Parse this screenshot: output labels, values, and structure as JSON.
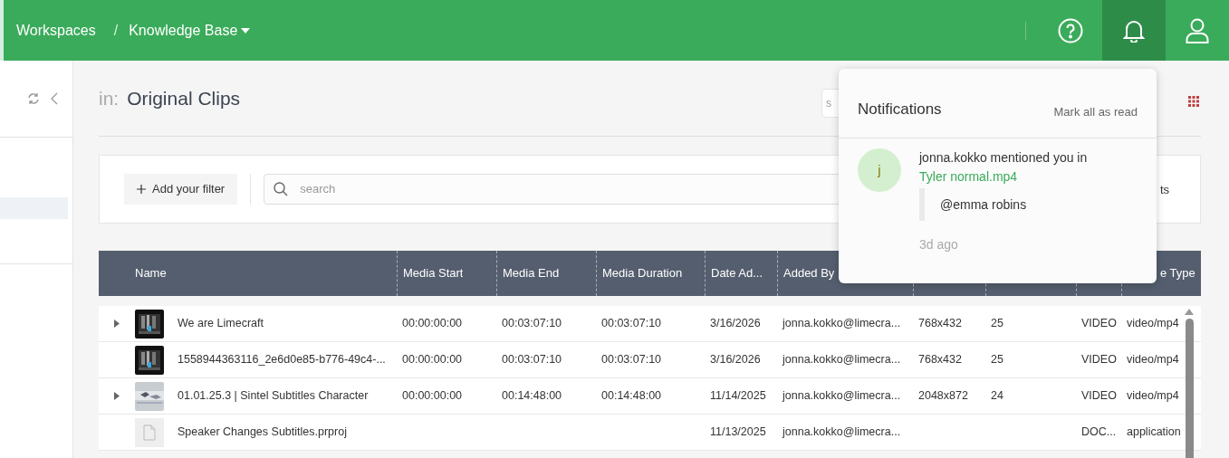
{
  "topbar": {
    "breadcrumbs": [
      {
        "label": "Workspaces",
        "kind": "link"
      },
      {
        "label": "/",
        "kind": "separator"
      },
      {
        "label": "Knowledge Base",
        "kind": "dropdown"
      }
    ],
    "icons": [
      {
        "kind": "help",
        "selected": false
      },
      {
        "kind": "bell",
        "selected": true
      },
      {
        "kind": "user",
        "selected": false
      }
    ]
  },
  "folder": {
    "prefix": "in:",
    "title": "Original Clips",
    "search_placeholder": "s"
  },
  "filter": {
    "button": "Add your filter",
    "search_placeholder": "search",
    "cut_button": "ts"
  },
  "table": {
    "columns": [
      "Name",
      "Media Start",
      "Media End",
      "Media Duration",
      "Date Ad...",
      "Added By",
      "",
      "",
      "",
      "e Type"
    ],
    "rows": [
      {
        "expandable": true,
        "kind": "dark",
        "cells": [
          "We are Limecraft",
          "00:00:00:00",
          "00:03:07:10",
          "00:03:07:10",
          "3/16/2026",
          "jonna.kokko@limecra...",
          "768x432",
          "25",
          "VIDEO",
          "video/mp4"
        ]
      },
      {
        "expandable": false,
        "kind": "dark",
        "cells": [
          "1558944363116_2e6d0e85-b776-49c4-...",
          "00:00:00:00",
          "00:03:07:10",
          "00:03:07:10",
          "3/16/2026",
          "jonna.kokko@limecra...",
          "768x432",
          "25",
          "VIDEO",
          "video/mp4"
        ]
      },
      {
        "expandable": true,
        "kind": "light",
        "cells": [
          "01.01.25.3 | Sintel Subtitles Character",
          "00:00:00:00",
          "00:14:48:00",
          "00:14:48:00",
          "11/14/2025",
          "jonna.kokko@limecra...",
          "2048x872",
          "24",
          "VIDEO",
          "video/mp4"
        ]
      },
      {
        "expandable": false,
        "kind": "file",
        "cells": [
          "Speaker Changes Subtitles.prproj",
          "",
          "",
          "",
          "11/13/2025",
          "jonna.kokko@limecra...",
          "",
          "",
          "DOC...",
          "application"
        ]
      }
    ]
  },
  "notifications": {
    "title": "Notifications",
    "mark_all": "Mark all as read",
    "items": [
      {
        "avatar": "j",
        "text": "jonna.kokko mentioned you in",
        "link": "Tyler normal.mp4",
        "quote": "@emma robins",
        "time": "3d ago"
      }
    ]
  }
}
